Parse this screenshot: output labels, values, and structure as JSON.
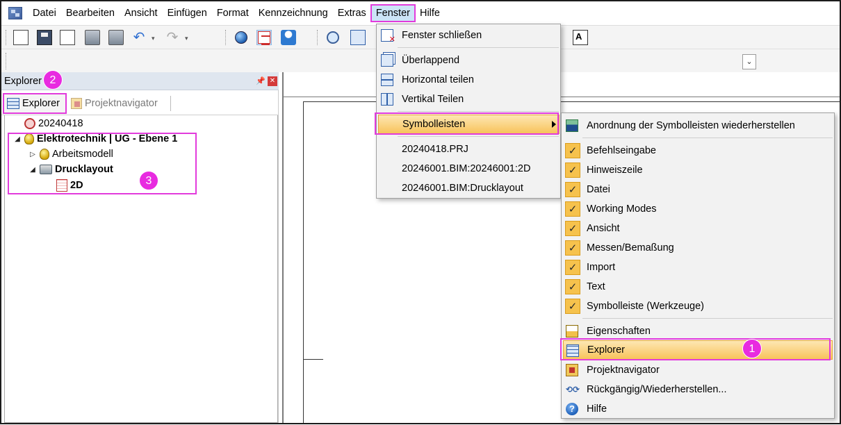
{
  "menubar": {
    "items": [
      "Datei",
      "Bearbeiten",
      "Ansicht",
      "Einfügen",
      "Format",
      "Kennzeichnung",
      "Extras",
      "Fenster",
      "Hilfe"
    ]
  },
  "explorer": {
    "title": "Explorer",
    "tabs": [
      "Explorer",
      "Projektnavigator"
    ],
    "tree": {
      "project": "20240418",
      "model": "Elektrotechnik | UG - Ebene 1",
      "child_arbeitsmodell": "Arbeitsmodell",
      "child_drucklayout": "Drucklayout",
      "leaf_2d": "2D"
    }
  },
  "fenster_menu": {
    "close": "Fenster schließen",
    "overlap": "Überlappend",
    "horizontal": "Horizontal teilen",
    "vertical": "Vertikal Teilen",
    "toolbars": "Symbolleisten",
    "windows": [
      "20240418.PRJ",
      "20246001.BIM:20246001:2D",
      "20246001.BIM:Drucklayout"
    ]
  },
  "toolbar_menu": {
    "restore": "Anordnung der Symbolleisten wiederherstellen",
    "checked": [
      "Befehlseingabe",
      "Hinweiszeile",
      "Datei",
      "Working Modes",
      "Ansicht",
      "Messen/Bemaßung",
      "Import",
      "Text",
      "Symbolleiste (Werkzeuge)"
    ],
    "properties": "Eigenschaften",
    "explorer": "Explorer",
    "project_navigator": "Projektnavigator",
    "undo_history": "Rückgängig/Wiederherstellen...",
    "help": "Hilfe"
  },
  "badges": [
    "1",
    "2",
    "3"
  ],
  "colors": {
    "highlight_frame": "#e23bdc",
    "badge": "#e82be0",
    "menu_hover": "#f8c35b",
    "checkmark_bg": "#f6c24d"
  }
}
